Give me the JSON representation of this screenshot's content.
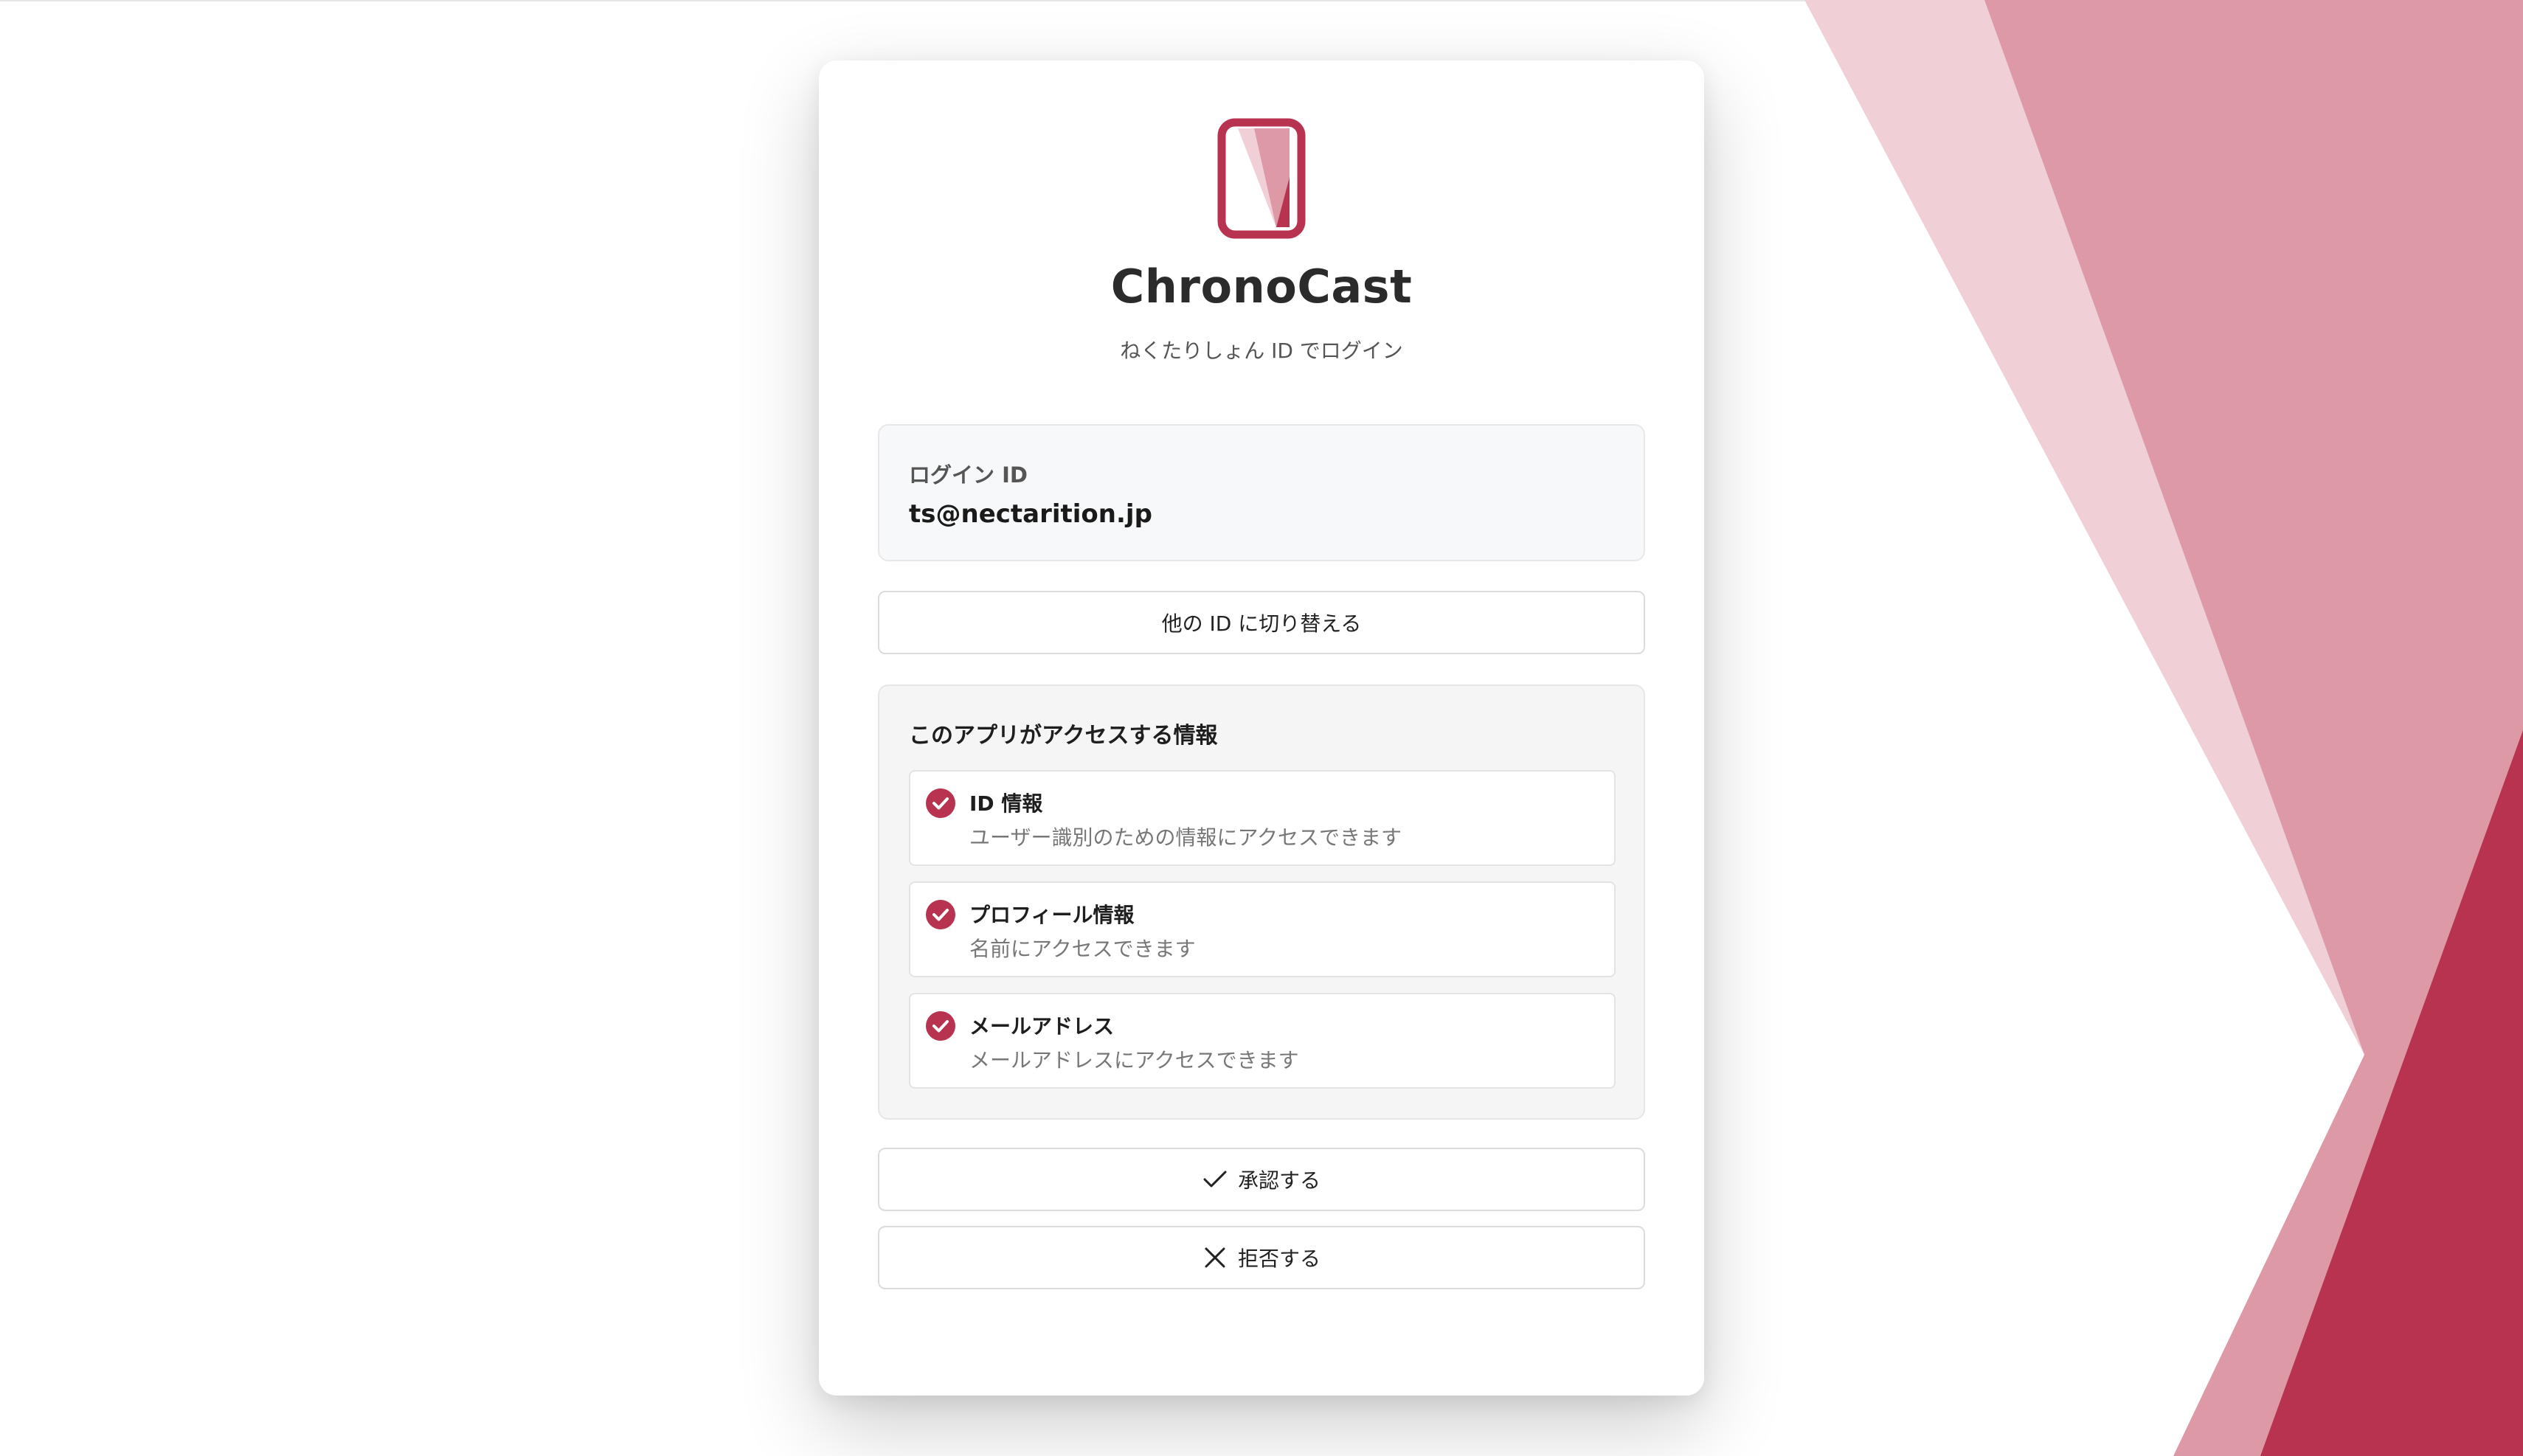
{
  "app": {
    "name": "ChronoCast",
    "subtitle": "ねくたりしょん ID でログイン"
  },
  "login": {
    "label": "ログイン ID",
    "value": "ts@nectarition.jp"
  },
  "switch_button_label": "他の ID に切り替える",
  "scopes": {
    "title": "このアプリがアクセスする情報",
    "items": [
      {
        "name": "ID 情報",
        "description": "ユーザー識別のための情報にアクセスできます"
      },
      {
        "name": "プロフィール情報",
        "description": "名前にアクセスできます"
      },
      {
        "name": "メールアドレス",
        "description": "メールアドレスにアクセスできます"
      }
    ]
  },
  "actions": {
    "approve_label": "承認する",
    "reject_label": "拒否する"
  },
  "colors": {
    "accent": "#b83350",
    "accent_light": "#dd9aa6",
    "accent_pale": "#f0cfd6"
  }
}
